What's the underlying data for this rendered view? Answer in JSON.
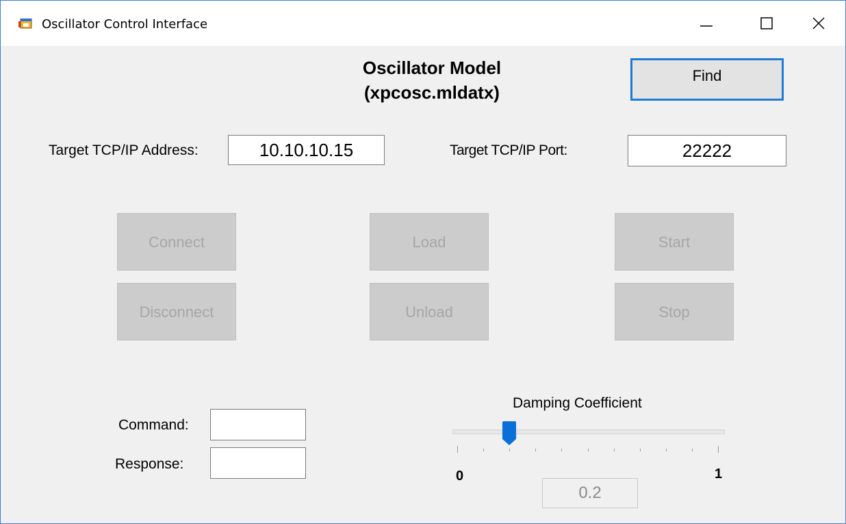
{
  "window": {
    "title": "Oscillator Control Interface",
    "controls": {
      "minimize": "minimize",
      "maximize": "maximize",
      "close": "close"
    },
    "accent_color": "#1f7ad6"
  },
  "header": {
    "model_line1": "Oscillator Model",
    "model_line2": "(xpcosc.mldatx)",
    "find_label": "Find"
  },
  "target": {
    "address_label": "Target TCP/IP Address:",
    "address_value": "10.10.10.15",
    "port_label": "Target TCP/IP Port:",
    "port_value": "22222"
  },
  "actions": {
    "connect": "Connect",
    "disconnect": "Disconnect",
    "load": "Load",
    "unload": "Unload",
    "start": "Start",
    "stop": "Stop",
    "state": "disabled"
  },
  "io": {
    "command_label": "Command:",
    "command_value": "",
    "response_label": "Response:",
    "response_value": ""
  },
  "damping": {
    "label": "Damping Coefficient",
    "min_label": "0",
    "max_label": "1",
    "value": 0.2,
    "value_text": "0.2",
    "tick_count": 11
  }
}
